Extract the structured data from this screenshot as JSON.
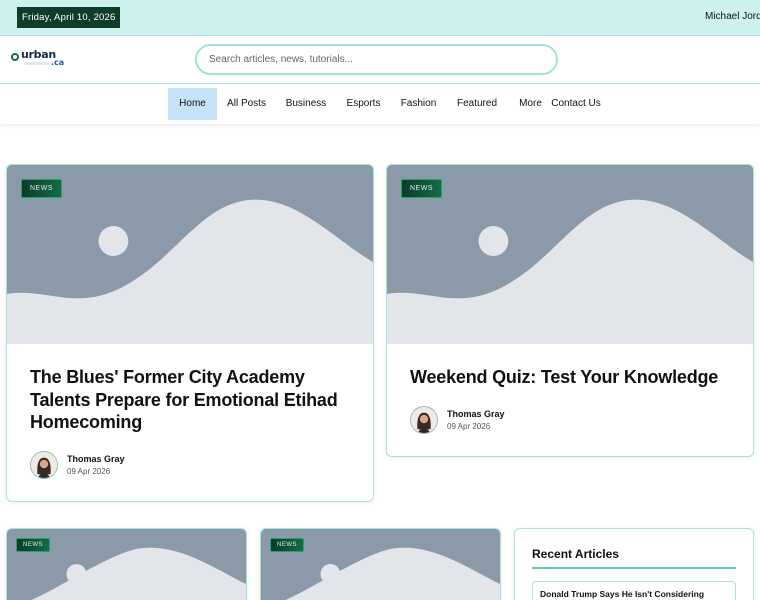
{
  "topbar": {
    "date": "Friday, April 10, 2026",
    "user_name": "Michael Jordan"
  },
  "header": {
    "logo": {
      "word": "urban",
      "tld": ".ca",
      "icon": "logo-mark"
    },
    "search": {
      "placeholder": "Search articles, news, tutorials..."
    }
  },
  "nav": {
    "items": [
      {
        "label": "Home",
        "active": true
      },
      {
        "label": "All Posts"
      },
      {
        "label": "Business"
      },
      {
        "label": "Esports"
      },
      {
        "label": "Fashion"
      },
      {
        "label": "Featured"
      },
      {
        "label": "More"
      },
      {
        "label": "Contact Us"
      }
    ]
  },
  "featured": [
    {
      "badge": "NEWS",
      "title": "The Blues' Former City Academy Talents Prepare for Emotional Etihad Homecoming",
      "author": "Thomas Gray",
      "date": "09 Apr 2026"
    },
    {
      "badge": "NEWS",
      "title": "Weekend Quiz: Test Your Knowledge",
      "author": "Thomas Gray",
      "date": "09 Apr 2026"
    }
  ],
  "grid": [
    {
      "badge": "NEWS"
    },
    {
      "badge": "NEWS"
    }
  ],
  "sidebar": {
    "heading": "Recent Articles",
    "items": [
      {
        "title": "Donald Trump Says He Isn't Considering"
      }
    ]
  },
  "colors": {
    "topbar_bg": "#ccf1ee",
    "accent": "#5dc9b8",
    "badge_bg": "#0f3d2a",
    "nav_active": "#c6e2f7",
    "placeholder_image": "#8a9aa9"
  }
}
